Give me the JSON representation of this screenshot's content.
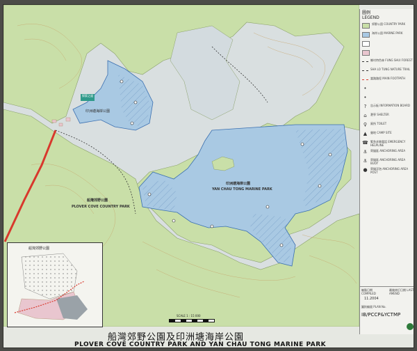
{
  "colors": {
    "land": "#c9dfa8",
    "water": "#a9c9e3",
    "marine_hatch": "#6f97c2",
    "country_park_boundary": "#3a6fb0",
    "contour": "#c7a36a",
    "road": "#d8382c",
    "developed": "#e9c6cf"
  },
  "map": {
    "hk_sign": "探索之道",
    "labels": [
      {
        "name": "park-label-zh",
        "text": "船灣郊野公園"
      },
      {
        "name": "park-label-en",
        "text": "PLOVER COVE COUNTRY PARK"
      },
      {
        "name": "marine-label-zh",
        "text": "印洲塘海岸公園"
      },
      {
        "name": "marine-label-en",
        "text": "YAN CHAU TONG MARINE PARK"
      }
    ],
    "scale": "SCALE 1 : 15 000"
  },
  "legend": {
    "title_zh": "圖例",
    "title_en": "LEGEND",
    "items": [
      {
        "symbol": "swatch",
        "color": "#c9dfa8",
        "text": "郊野公園 COUNTRY PARK"
      },
      {
        "symbol": "swatch",
        "color": "#a9c9e3",
        "text": "海岸公園 MARINE PARK"
      },
      {
        "symbol": "swatch",
        "color": "#ffffff",
        "text": ""
      },
      {
        "symbol": "swatch",
        "color": "#e9c6cf",
        "text": ""
      },
      {
        "symbol": "line",
        "color": "#333333",
        "text": "鄉村特色林 FUNG SHUI FOREST"
      },
      {
        "symbol": "line",
        "color": "#333333",
        "text": "SHA LO TUNG NATURE TRAIL"
      },
      {
        "symbol": "line",
        "color": "#d8382c",
        "text": "當路路徑 MAIN FOOTPATH"
      },
      {
        "symbol": "dot",
        "color": "#333333",
        "text": ""
      },
      {
        "symbol": "dot",
        "color": "#333333",
        "text": ""
      },
      {
        "symbol": "glyph",
        "glyph": "?",
        "text": "告示板 INFORMATION BOARD"
      },
      {
        "symbol": "glyph",
        "glyph": "⌂",
        "text": "淝亭 SHELTER"
      },
      {
        "symbol": "glyph",
        "glyph": "♀",
        "text": "廁所 TOILET"
      },
      {
        "symbol": "glyph",
        "glyph": "▲",
        "text": "營地 CAMP SITE"
      },
      {
        "symbol": "glyph",
        "glyph": "☎",
        "text": "緊急求救電話 EMERGENCY HELPLINE"
      },
      {
        "symbol": "glyph",
        "glyph": "⚓",
        "text": "寄錨區 ANCHORING AREA"
      },
      {
        "symbol": "glyph",
        "glyph": "⚓",
        "text": "寄錨區 ANCHORING AREA BUOY"
      },
      {
        "symbol": "glyph",
        "glyph": "●",
        "text": "寄錨浮泡 ANCHORING AREA POST"
      }
    ]
  },
  "info": {
    "compiled_label": "編製日期 COMPILED",
    "compiled_value": "11.2004",
    "amend_label": "最後修訂日期 LAST AMEND",
    "plan_label": "圖則編號 PLAN No.",
    "plan_code": "IB/PCCP&YCTMP"
  },
  "title": {
    "zh": "船灣郊野公園及印洲塘海岸公園",
    "en": "PLOVER COVE COUNTRY PARK AND YAN CHAU TONG MARINE PARK"
  },
  "inset": {
    "title": "船灣郊野公園"
  }
}
